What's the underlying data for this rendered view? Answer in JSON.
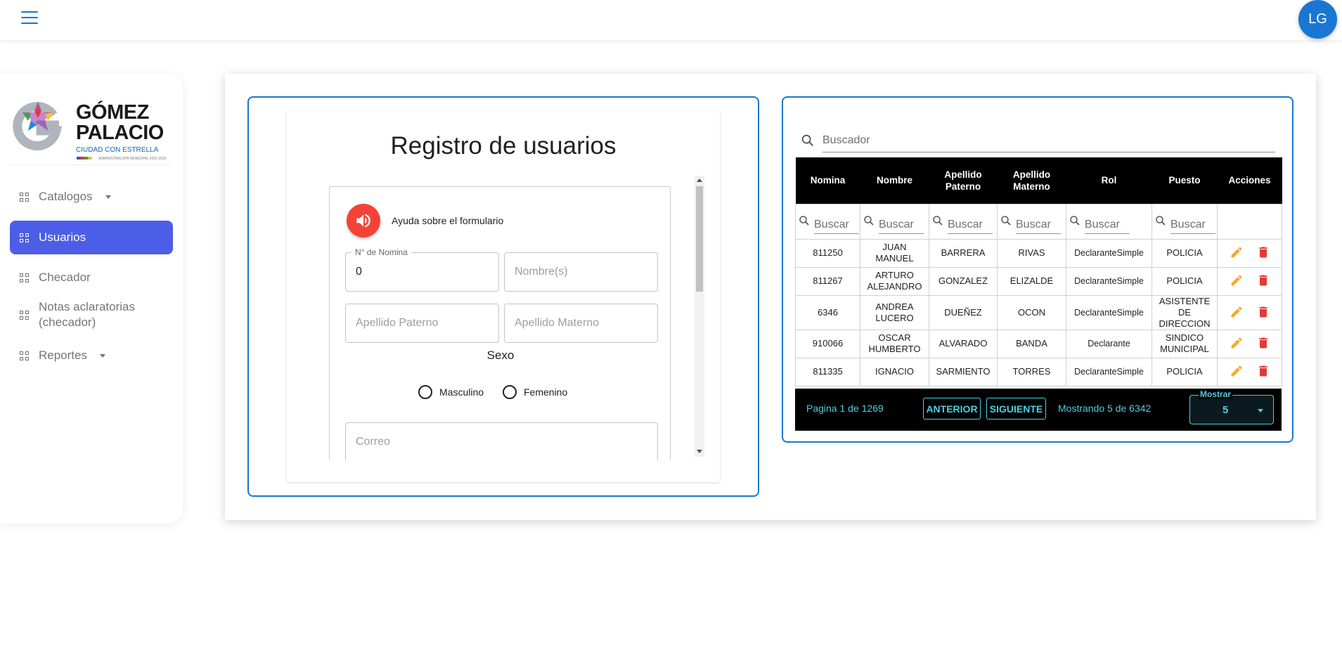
{
  "header": {
    "avatar_initials": "LG"
  },
  "logo": {
    "line1": "GÓMEZ",
    "line2": "PALACIO",
    "tagline": "CIUDAD CON ESTRELLA",
    "small": "ADMINISTRACIÓN MUNICIPAL 2022-2025"
  },
  "sidebar": {
    "items": [
      {
        "label": "Catalogos",
        "has_caret": true,
        "active": false
      },
      {
        "label": "Usuarios",
        "has_caret": false,
        "active": true
      },
      {
        "label": "Checador",
        "has_caret": false,
        "active": false
      },
      {
        "label": "Notas aclaratorias (checador)",
        "has_caret": false,
        "active": false
      },
      {
        "label": "Reportes",
        "has_caret": true,
        "active": false
      }
    ]
  },
  "form": {
    "title": "Registro de usuarios",
    "help_text": "Ayuda sobre el formulario",
    "nomina_label": "N° de Nomina",
    "nomina_value": "0",
    "nombre_placeholder": "Nombre(s)",
    "apellido_paterno_placeholder": "Apellido Paterno",
    "apellido_materno_placeholder": "Apellido Materno",
    "sexo_label": "Sexo",
    "sexo_options": [
      "Masculino",
      "Femenino"
    ],
    "correo_placeholder": "Correo"
  },
  "table": {
    "search_placeholder": "Buscador",
    "filter_placeholder": "Buscar",
    "headers": [
      "Nomina",
      "Nombre",
      "Apellido Paterno",
      "Apellido Materno",
      "Rol",
      "Puesto",
      "Acciones"
    ],
    "rows": [
      [
        "811250",
        "JUAN MANUEL",
        "BARRERA",
        "RIVAS",
        "DeclaranteSimple",
        "POLICIA"
      ],
      [
        "811267",
        "ARTURO ALEJANDRO",
        "GONZALEZ",
        "ELIZALDE",
        "DeclaranteSimple",
        "POLICIA"
      ],
      [
        "6346",
        "ANDREA LUCERO",
        "DUEÑEZ",
        "OCON",
        "DeclaranteSimple",
        "ASISTENTE DE DIRECCION"
      ],
      [
        "910066",
        "OSCAR HUMBERTO",
        "ALVARADO",
        "BANDA",
        "Declarante",
        "SINDICO MUNICIPAL"
      ],
      [
        "811335",
        "IGNACIO",
        "SARMIENTO",
        "TORRES",
        "DeclaranteSimple",
        "POLICIA"
      ]
    ],
    "colors": {
      "edit": "#f9a825",
      "delete": "#e53935",
      "pager_accent": "#4dd0e1"
    }
  },
  "pager": {
    "page_text": "Pagina 1 de 1269",
    "prev_label": "ANTERIOR",
    "next_label": "SIGUIENTE",
    "showing_text": "Mostrando 5 de 6342",
    "show_label": "Mostrar",
    "show_value": "5"
  }
}
